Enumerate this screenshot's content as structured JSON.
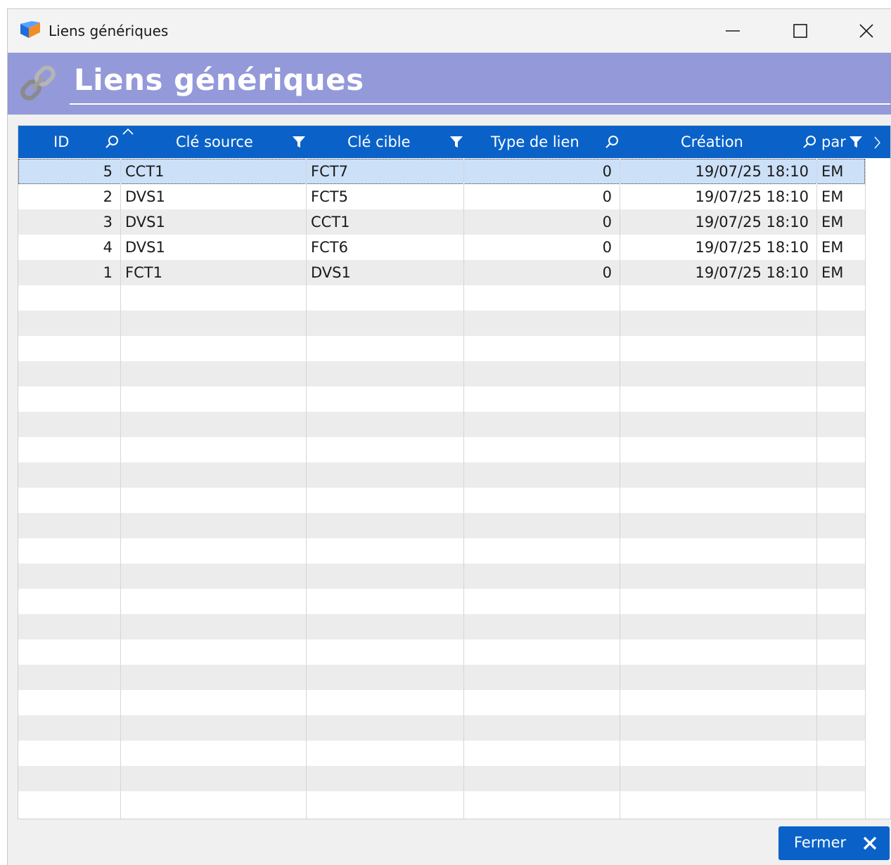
{
  "window": {
    "title": "Liens génériques"
  },
  "header": {
    "title": "Liens génériques"
  },
  "grid": {
    "columns": [
      {
        "label": "ID",
        "icon": "search-icon"
      },
      {
        "label": "Clé source",
        "icon": "filter-icon"
      },
      {
        "label": "Clé cible",
        "icon": "filter-icon"
      },
      {
        "label": "Type de lien",
        "icon": "search-icon"
      },
      {
        "label": "Création",
        "icon": "search-icon"
      },
      {
        "label": "par",
        "icon": "filter-icon"
      }
    ],
    "sort_indicator": "sort-ascending-icon",
    "rows": [
      {
        "id": "5",
        "source": "CCT1",
        "target": "FCT7",
        "type": "0",
        "created": "19/07/25 18:10",
        "by": "EM",
        "selected": true
      },
      {
        "id": "2",
        "source": "DVS1",
        "target": "FCT5",
        "type": "0",
        "created": "19/07/25 18:10",
        "by": "EM",
        "selected": false
      },
      {
        "id": "3",
        "source": "DVS1",
        "target": "CCT1",
        "type": "0",
        "created": "19/07/25 18:10",
        "by": "EM",
        "selected": false
      },
      {
        "id": "4",
        "source": "DVS1",
        "target": "FCT6",
        "type": "0",
        "created": "19/07/25 18:10",
        "by": "EM",
        "selected": false
      },
      {
        "id": "1",
        "source": "FCT1",
        "target": "DVS1",
        "type": "0",
        "created": "19/07/25 18:10",
        "by": "EM",
        "selected": false
      }
    ]
  },
  "footer": {
    "close_label": "Fermer"
  },
  "colors": {
    "header_band": "#9399d9",
    "grid_header": "#0a62c9",
    "selected_row": "#cce0f8",
    "alt_row": "#ececec"
  }
}
